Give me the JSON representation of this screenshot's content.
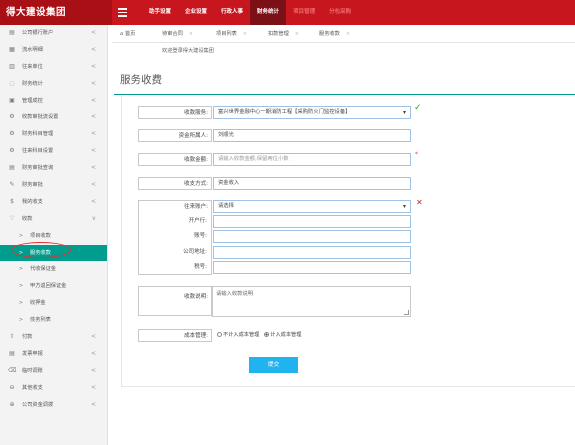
{
  "header": {
    "logo": "得大建设集团",
    "nav": [
      "助手设置",
      "企业设置",
      "行政人事",
      "财务统计",
      "项目管理",
      "分包采购"
    ],
    "active_nav_index": 3,
    "dim_nav_indices": [
      4,
      5
    ]
  },
  "sidebar": {
    "items": [
      {
        "label": "公司银行账户",
        "icon": "document-icon",
        "glyph": "▤",
        "arrow": "<"
      },
      {
        "label": "流水明细",
        "icon": "list-icon",
        "glyph": "▦",
        "arrow": "<"
      },
      {
        "label": "往来单位",
        "icon": "folder-icon",
        "glyph": "▥",
        "arrow": "<"
      },
      {
        "label": "财务统计",
        "icon": "refresh-icon",
        "glyph": "◌",
        "arrow": "<"
      },
      {
        "label": "管理成控",
        "icon": "grid-icon",
        "glyph": "▣",
        "arrow": "<"
      },
      {
        "label": "收款审批流设置",
        "icon": "gear-icon",
        "glyph": "⚙",
        "arrow": "<"
      },
      {
        "label": "财务科目管理",
        "icon": "gear-icon",
        "glyph": "⚙",
        "arrow": "<"
      },
      {
        "label": "往来科目设置",
        "icon": "gear-icon",
        "glyph": "⚙",
        "arrow": "<"
      },
      {
        "label": "财务审批查询",
        "icon": "table-icon",
        "glyph": "▤",
        "arrow": "<"
      },
      {
        "label": "财务审批",
        "icon": "edit-icon",
        "glyph": "✎",
        "arrow": "<"
      },
      {
        "label": "我的收支",
        "icon": "dollar-icon",
        "glyph": "$",
        "arrow": "<"
      },
      {
        "label": "收款",
        "icon": "heart-icon",
        "glyph": "♡",
        "arrow": "∨"
      },
      {
        "label": "项目收款",
        "icon": "chevron-right-icon",
        "glyph": ">",
        "arrow": "",
        "sub": true
      },
      {
        "label": "服务收款",
        "icon": "chevron-right-icon",
        "glyph": ">",
        "arrow": "",
        "sub": true,
        "active": true
      },
      {
        "label": "代收保证金",
        "icon": "chevron-right-icon",
        "glyph": ">",
        "arrow": "",
        "sub": true
      },
      {
        "label": "甲方返回保证金",
        "icon": "chevron-right-icon",
        "glyph": ">",
        "arrow": "",
        "sub": true
      },
      {
        "label": "收押金",
        "icon": "chevron-right-icon",
        "glyph": ">",
        "arrow": "",
        "sub": true
      },
      {
        "label": "债务列表",
        "icon": "chevron-right-icon",
        "glyph": ">",
        "arrow": "",
        "sub": true
      },
      {
        "label": "付款",
        "icon": "upload-icon",
        "glyph": "⇧",
        "arrow": "<"
      },
      {
        "label": "发票申报",
        "icon": "invoice-icon",
        "glyph": "▤",
        "arrow": "<"
      },
      {
        "label": "临时调账",
        "icon": "tag-icon",
        "glyph": "⌫",
        "arrow": "<"
      },
      {
        "label": "其他收支",
        "icon": "circle-minus-icon",
        "glyph": "⊖",
        "arrow": "<"
      },
      {
        "label": "公司资金调拨",
        "icon": "transfer-icon",
        "glyph": "⊕",
        "arrow": "<"
      }
    ]
  },
  "tabs": {
    "home_icon": "⌂",
    "items": [
      "首页",
      "待审合同",
      "项目列表",
      "扣款管理",
      "服务收款"
    ],
    "close": "×"
  },
  "welcome": "欢迎登录得大建设集团",
  "page": {
    "title": "服务收费"
  },
  "form": {
    "service_label": "收款服务:",
    "service_value": "富兴世界金融中心一期消防工程【采购防火门监控设备】",
    "service_check": "✓",
    "fund_person_label": "资金所属人:",
    "fund_person_value": "刘顺光",
    "amount_label": "收款金额:",
    "amount_placeholder": "请输入收款金额,保留两位小数",
    "amount_required": "*",
    "method_label": "收支方式:",
    "method_value": "资金收入",
    "account_label": "往来账户:",
    "account_value": "请选择",
    "account_error": "✕",
    "bank_label": "开户行:",
    "account_no_label": "账号:",
    "company_address_label": "公司地址:",
    "tax_no_label": "税号:",
    "note_label": "收款说明:",
    "note_placeholder": "请输入收款说明",
    "cost_label": "成本管理:",
    "cost_options": [
      "不计入成本管理",
      "计入成本管理"
    ],
    "cost_selected_index": 1,
    "submit_label": "提交"
  }
}
